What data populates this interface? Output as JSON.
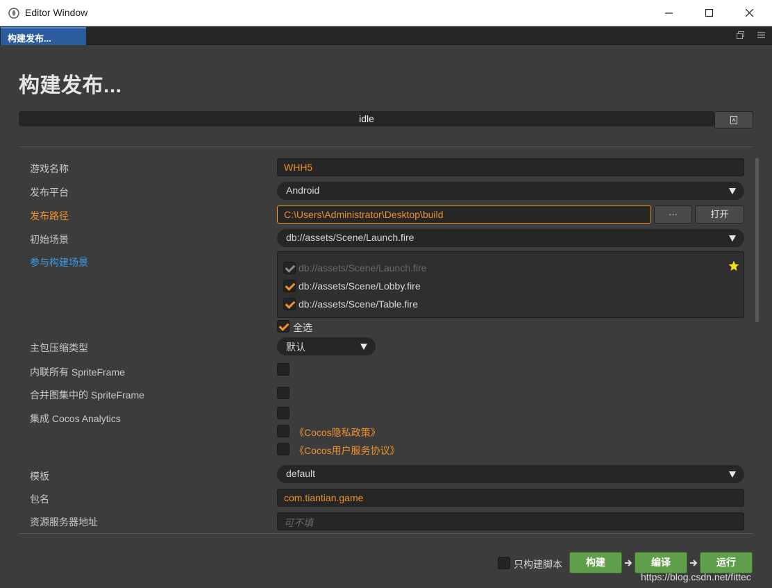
{
  "window": {
    "title": "Editor Window"
  },
  "tab": {
    "label": "构建发布..."
  },
  "page": {
    "heading": "构建发布...",
    "status": "idle"
  },
  "form": {
    "game_name": {
      "label": "游戏名称",
      "value": "WHH5"
    },
    "platform": {
      "label": "发布平台",
      "value": "Android"
    },
    "build_path": {
      "label": "发布路径",
      "value": "C:\\Users\\Administrator\\Desktop\\build",
      "browse_label": "···",
      "open_label": "打开"
    },
    "start_scene": {
      "label": "初始场景",
      "value": "db://assets/Scene/Launch.fire"
    },
    "scenes": {
      "label": "参与构建场景",
      "items": [
        {
          "path": "db://assets/Scene/Launch.fire",
          "checked": true,
          "disabled": true
        },
        {
          "path": "db://assets/Scene/Lobby.fire",
          "checked": true,
          "disabled": false
        },
        {
          "path": "db://assets/Scene/Table.fire",
          "checked": true,
          "disabled": false
        }
      ],
      "select_all_label": "全选"
    },
    "compression": {
      "label": "主包压缩类型",
      "value": "默认"
    },
    "inline_sprite": {
      "label": "内联所有 SpriteFrame"
    },
    "merge_sprite": {
      "label": "合并图集中的 SpriteFrame"
    },
    "analytics": {
      "label": "集成 Cocos Analytics",
      "privacy_link": "《Cocos隐私政策》",
      "service_link": "《Cocos用户服务协议》"
    },
    "template": {
      "label": "模板",
      "value": "default"
    },
    "package_name": {
      "label": "包名",
      "value": "com.tiantian.game"
    },
    "resource_server": {
      "label": "资源服务器地址",
      "placeholder": "可不填"
    }
  },
  "footer": {
    "script_only_label": "只构建脚本",
    "build_label": "构建",
    "compile_label": "编译",
    "run_label": "运行",
    "watermark": "https://blog.csdn.net/fittec"
  },
  "colors": {
    "accent": "#f0922b",
    "link_blue": "#3d9be9",
    "green": "#5f9e4b",
    "tab_blue": "#2d5c9e"
  }
}
